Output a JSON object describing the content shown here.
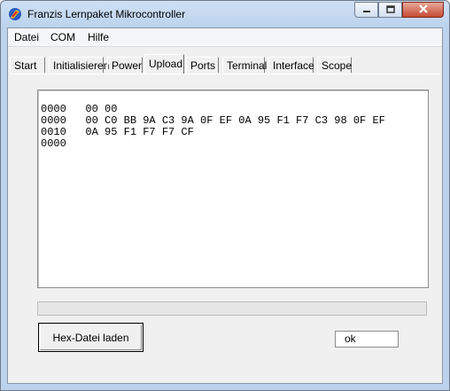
{
  "window": {
    "title": "Franzis Lernpaket Mikrocontroller",
    "icon": "app-logo-icon",
    "controls": [
      "minimize-icon",
      "maximize-icon",
      "close-icon"
    ]
  },
  "menu": {
    "items": [
      "Datei",
      "COM",
      "Hilfe"
    ]
  },
  "tabs": {
    "items": [
      "Start",
      "Initialisieren",
      "Power",
      "Upload",
      "Ports",
      "Terminal",
      "Interface",
      "Scope"
    ],
    "active": "Upload"
  },
  "hex": {
    "lines": [
      "0000   00 00",
      "0000   00 C0 BB 9A C3 9A 0F EF 0A 95 F1 F7 C3 98 0F EF",
      "0010   0A 95 F1 F7 F7 CF",
      "0000"
    ]
  },
  "progress": {
    "value": 0
  },
  "actions": {
    "load_label": "Hex-Datei laden"
  },
  "status": {
    "text": "ok"
  },
  "colors": {
    "titlebar": "#bcd3ee",
    "client_bg": "#f0f0f0",
    "close_button": "#c54a32"
  }
}
